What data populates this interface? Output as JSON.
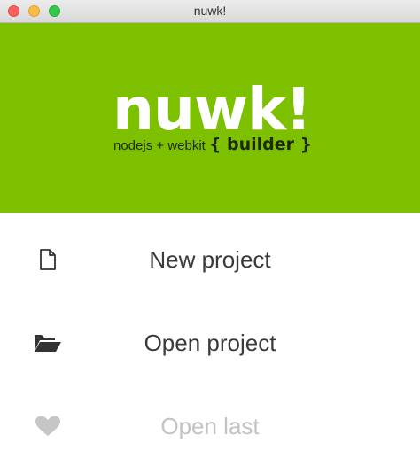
{
  "window": {
    "title": "nuwk!"
  },
  "banner": {
    "logo": "nuwk!",
    "tagline_small": "nodejs + webkit",
    "tagline_big": "{ builder }",
    "background_color": "#7cc000"
  },
  "menu": {
    "items": [
      {
        "label": "New project",
        "icon": "file-icon",
        "enabled": true
      },
      {
        "label": "Open project",
        "icon": "folder-open-icon",
        "enabled": true
      },
      {
        "label": "Open last",
        "icon": "heart-icon",
        "enabled": false
      }
    ]
  }
}
